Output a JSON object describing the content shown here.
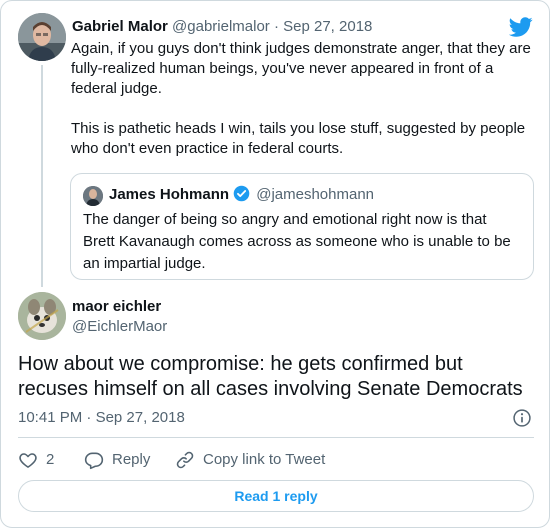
{
  "parent_tweet": {
    "author_name": "Gabriel Malor",
    "handle": "@gabrielmalor",
    "separator": " · ",
    "date": "Sep 27, 2018",
    "paragraphs": [
      "Again, if you guys don't think judges demonstrate anger, that they are fully-realized human beings, you've never appeared in front of a federal judge.",
      "This is pathetic heads I win, tails you lose stuff, suggested by people who don't even practice in federal courts."
    ]
  },
  "quoted_tweet": {
    "author_name": "James Hohmann",
    "handle": "@jameshohmann",
    "text": "The danger of being so angry and emotional right now is that Brett Kavanaugh comes across as someone who is unable to be an impartial judge."
  },
  "main_tweet": {
    "author_name": "maor eichler",
    "handle": "@EichlerMaor",
    "text": "How about we compromise: he gets confirmed but recuses himself on all cases involving Senate Democrats",
    "time": "10:41 PM",
    "separator": " · ",
    "date": "Sep 27, 2018"
  },
  "actions": {
    "like_count": "2",
    "reply_label": "Reply",
    "copy_link_label": "Copy link to Tweet"
  },
  "read_replies_label": "Read 1 reply",
  "colors": {
    "accent": "#1d9bf0",
    "text": "#0f1419",
    "muted": "#536471",
    "border": "#cfd9de"
  },
  "icons": [
    "twitter-bird-icon",
    "verified-badge-icon",
    "info-icon",
    "heart-icon",
    "reply-bubble-icon",
    "link-icon"
  ]
}
